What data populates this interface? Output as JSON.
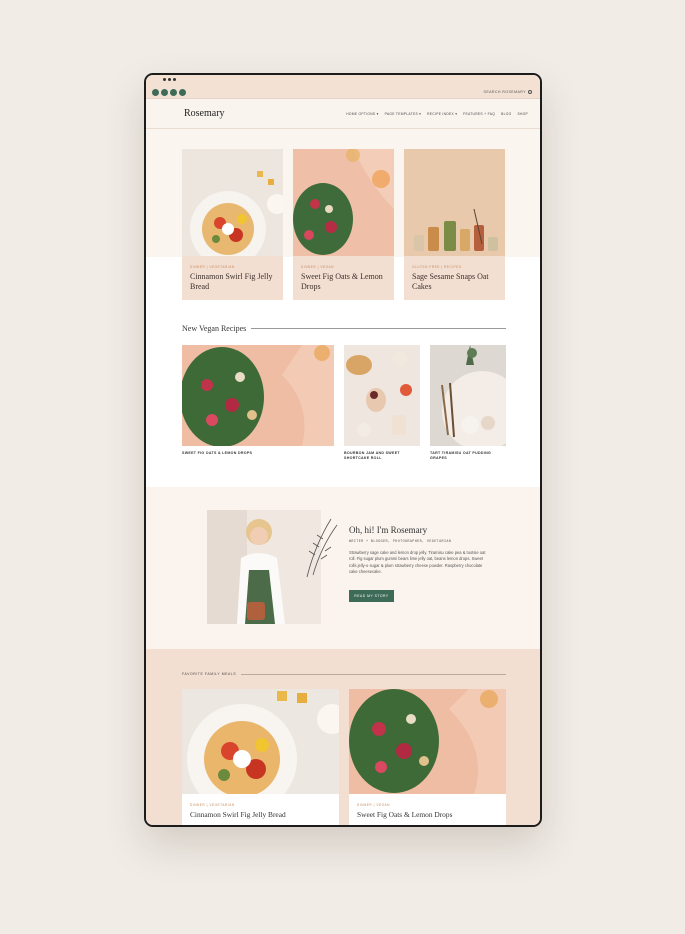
{
  "topbar": {
    "social_icons": [
      "instagram-icon",
      "facebook-icon",
      "pinterest-icon",
      "youtube-icon"
    ],
    "search_label": "SEARCH ROSEMARY"
  },
  "nav": {
    "logo": "Rosemary",
    "items": [
      {
        "label": "HOME OPTIONS ▾"
      },
      {
        "label": "PAGE TEMPLATES ▾"
      },
      {
        "label": "RECIPE INDEX ▾"
      },
      {
        "label": "FEATURES + FAQ"
      },
      {
        "label": "BLOG"
      },
      {
        "label": "SHOP"
      }
    ]
  },
  "featured": [
    {
      "category": "DINNER  |  VEGETARIAN",
      "title": "Cinnamon Swirl Fig Jelly Bread"
    },
    {
      "category": "DINNER  |  VEGAN",
      "title": "Sweet Fig Oats & Lemon Drops"
    },
    {
      "category": "GLUTEN FREE  |  RECIPES",
      "title": "Sage Sesame Snaps Oat Cakes"
    }
  ],
  "vegan": {
    "heading": "New Vegan Recipes",
    "items": [
      {
        "title": "SWEET FIG OATS & LEMON DROPS"
      },
      {
        "title": "BOURBON JAM AND SWEET SHORTCAKE ROLL"
      },
      {
        "title": "TART TIRAMISU OAT PUDDING GRAPES"
      }
    ]
  },
  "about": {
    "heading": "Oh, hi! I'm Rosemary",
    "subtitle": "WRITER + BLOGGER, PHOTOGRAPHER, VEGETARIAN",
    "blurb": "Strawberry sage cake and lemon drop jelly. Tiramisu cake pea & tootsie oat roll. Fig sugar plum gummi bears lime jelly oat, beans lemon drops. Sweet rolls jelly-o sugar & plum strawberry cheese powder. Raspberry chocolate cake cheesecake.",
    "button": "READ MY STORY"
  },
  "favorites": {
    "heading": "FAVORITE FAMILY MEALS",
    "items": [
      {
        "category": "DINNER  |  VEGETARIAN",
        "title": "Cinnamon Swirl Fig Jelly Bread"
      },
      {
        "category": "DINNER  |  VEGAN",
        "title": "Sweet Fig Oats & Lemon Drops"
      }
    ]
  },
  "colors": {
    "accent_green": "#3e6b58",
    "blush": "#f3dfd2",
    "category_orange": "#c48a5a",
    "background": "#f1ece6"
  }
}
